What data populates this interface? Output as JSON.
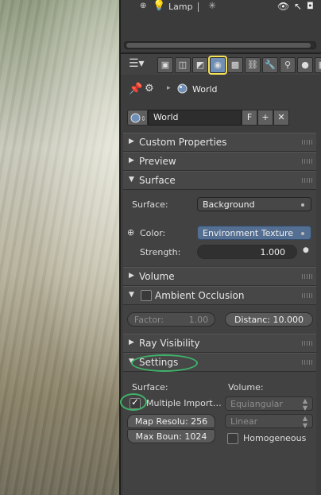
{
  "outliner": {
    "lamp_label": "Lamp"
  },
  "toolbar": {
    "tabs": [
      "render-icon",
      "scene-icon",
      "render-layers-icon",
      "world-icon",
      "object-icon",
      "constraints-icon",
      "modifiers-icon",
      "data-icon",
      "material-icon",
      "texture-icon"
    ],
    "active_tab": "world-icon"
  },
  "breadcrumb": {
    "label": "World"
  },
  "world_selector": {
    "name": "World",
    "fake_user": "F",
    "add": "+",
    "close": "✕"
  },
  "panels": {
    "custom_properties": "Custom Properties",
    "preview": "Preview",
    "surface": "Surface",
    "volume": "Volume",
    "ambient_occlusion": "Ambient Occlusion",
    "ray_visibility": "Ray Visibility",
    "settings": "Settings"
  },
  "surface": {
    "surface_label": "Surface:",
    "surface_value": "Background",
    "color_label": "Color:",
    "color_value": "Environment Texture",
    "strength_label": "Strength:",
    "strength_value": "1.000"
  },
  "ambient_occlusion": {
    "factor_label": "Factor:",
    "factor_value": "1.00",
    "distance": "Distanc: 10.000"
  },
  "settings": {
    "surface_label": "Surface:",
    "volume_label": "Volume:",
    "multiple_importance": "Multiple Import…",
    "map_resolution": "Map Resolu: 256",
    "max_bounces": "Max Boun: 1024",
    "volume_sampling": "Equiangular",
    "volume_interpolation": "Linear",
    "homogeneous": "Homogeneous"
  },
  "colors": {
    "highlight": "#3fb36a",
    "active_tab": "#f6e25a",
    "env_field": "#546f92"
  }
}
